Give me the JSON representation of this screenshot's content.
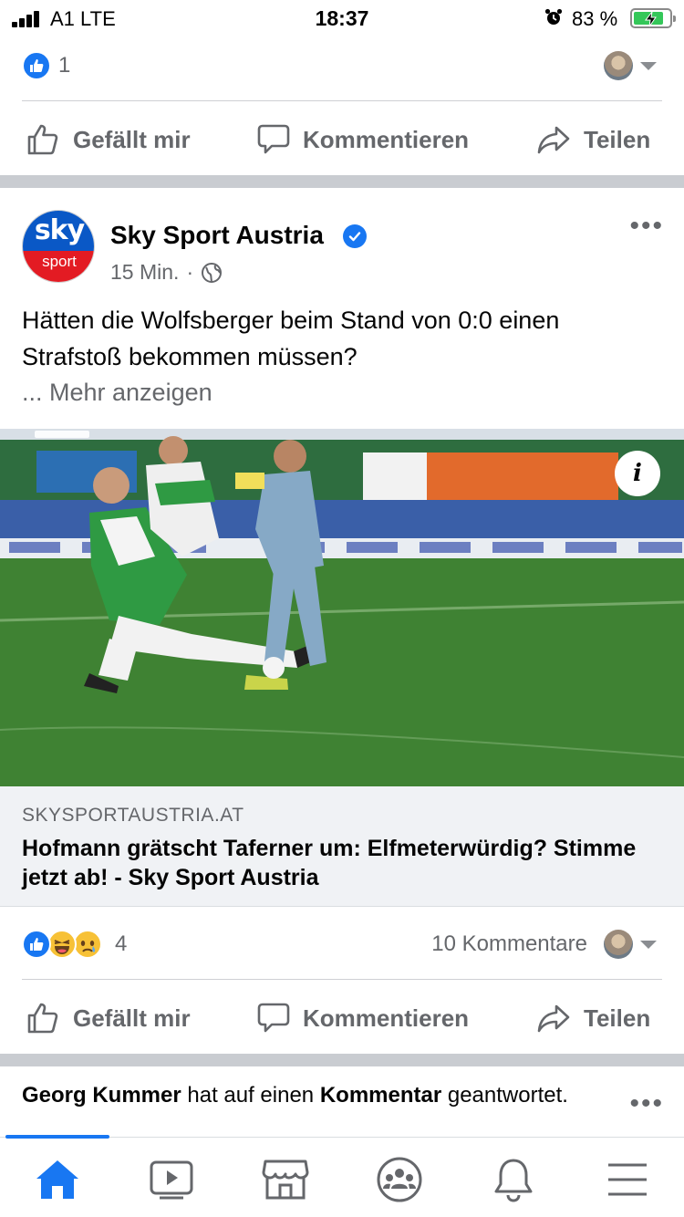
{
  "status_bar": {
    "carrier": "A1  LTE",
    "time": "18:37",
    "battery_percent": "83 %",
    "battery_level": 0.83
  },
  "prev_post": {
    "reaction_count": "1",
    "actions": {
      "like": "Gefällt mir",
      "comment": "Kommentieren",
      "share": "Teilen"
    }
  },
  "post": {
    "page_name": "Sky Sport Austria",
    "avatar_brand": "sky",
    "avatar_sub": "sport",
    "time_ago": "15 Min.",
    "meta_separator": "·",
    "text": "Hätten die Wolfsberger beim Stand von 0:0 einen Strafstoß bekommen müssen?",
    "see_more": "... Mehr anzeigen",
    "media_info_label": "i",
    "link": {
      "domain": "SKYSPORTAUSTRIA.AT",
      "title": "Hofmann grätscht Taferner um: Elfmeterwürdig? Stimme jetzt ab! - Sky Sport Austria"
    },
    "reaction_count": "4",
    "comments_count": "10 Kommentare",
    "actions": {
      "like": "Gefällt mir",
      "comment": "Kommentieren",
      "share": "Teilen"
    }
  },
  "next_post": {
    "actor": "Georg Kummer",
    "middle": " hat auf einen ",
    "object": "Kommentar",
    "tail": " geantwortet."
  },
  "bottom_nav": {
    "items": [
      "home-icon",
      "watch-icon",
      "marketplace-icon",
      "groups-icon",
      "notifications-icon",
      "menu-icon"
    ],
    "active": "home-icon"
  },
  "colors": {
    "accent": "#1877f2",
    "secondary_text": "#65676b",
    "separator": "#c9ccd1",
    "battery_green": "#34c759",
    "sky_blue": "#0a58c6",
    "sky_red": "#e31b23"
  }
}
